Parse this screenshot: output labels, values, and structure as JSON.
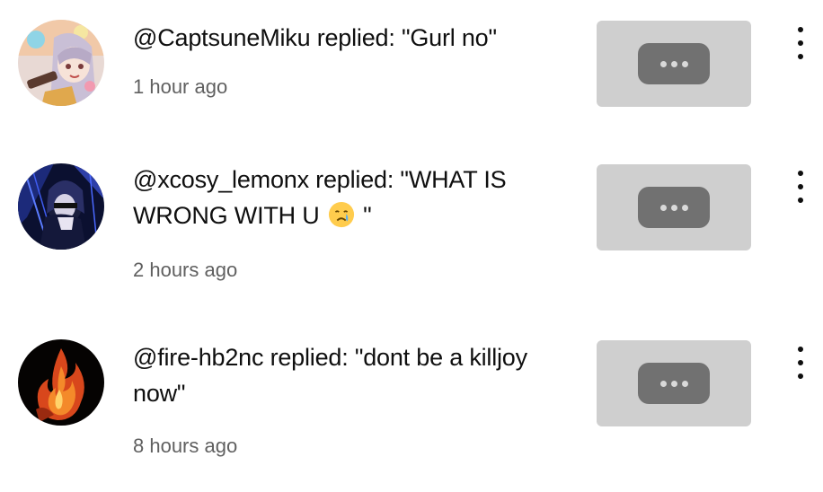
{
  "notifications": [
    {
      "message": "@CaptsuneMiku replied: \"Gurl no\"",
      "time": "1 hour ago",
      "avatar_icon": "anime-character-avatar-icon",
      "thumbnail_icon": "comment-bubble-thumbnail-icon"
    },
    {
      "message_before_emoji": "@xcosy_lemonx replied: \"WHAT IS WRONG WITH U ",
      "emoji_icon": "crying-face-emoji-icon",
      "message_after_emoji": " \"",
      "time": "2 hours ago",
      "avatar_icon": "dark-blue-figure-avatar-icon",
      "thumbnail_icon": "comment-bubble-thumbnail-icon"
    },
    {
      "message": "@fire-hb2nc replied: \"dont be a killjoy now\"",
      "time": "8 hours ago",
      "avatar_icon": "flame-avatar-icon",
      "thumbnail_icon": "comment-bubble-thumbnail-icon"
    }
  ],
  "colors": {
    "text_primary": "#0f0f0f",
    "text_secondary": "#606060",
    "thumbnail_bg": "#cfcfcf",
    "thumbnail_bubble": "#717171"
  },
  "more_menu_icon": "more-vertical-icon"
}
